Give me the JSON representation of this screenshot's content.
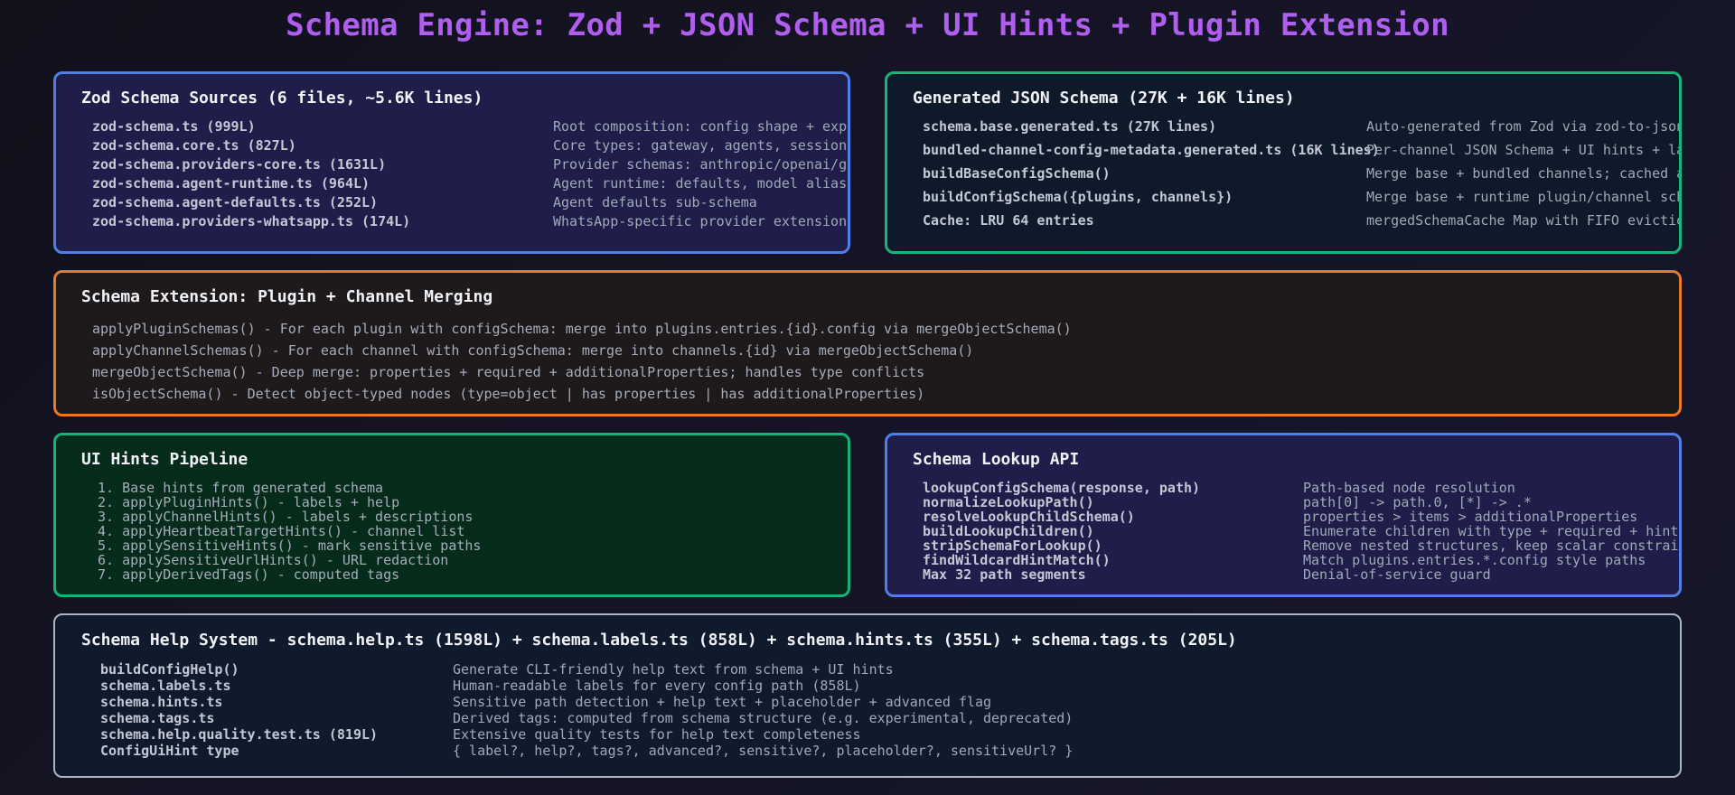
{
  "title": "Schema Engine: Zod + JSON Schema + UI Hints + Plugin Extension",
  "colors": {
    "title": "#b05ef0",
    "blue_border": "#4f7fe6",
    "green_border": "#17b57e",
    "orange_border": "#e8792a",
    "gray_border": "#aeb5c2"
  },
  "zod": {
    "title": "Zod Schema Sources (6 files, ~5.6K lines)",
    "rows": [
      {
        "k": "zod-schema.ts (999L)",
        "v": "Root composition: config shape + exports"
      },
      {
        "k": "zod-schema.core.ts (827L)",
        "v": "Core types: gateway, agents, sessions, lo"
      },
      {
        "k": "zod-schema.providers-core.ts (1631L)",
        "v": "Provider schemas: anthropic/openai/google"
      },
      {
        "k": "zod-schema.agent-runtime.ts (964L)",
        "v": "Agent runtime: defaults, model aliases, c"
      },
      {
        "k": "zod-schema.agent-defaults.ts (252L)",
        "v": "Agent defaults sub-schema"
      },
      {
        "k": "zod-schema.providers-whatsapp.ts (174L)",
        "v": "WhatsApp-specific provider extensions"
      }
    ]
  },
  "json": {
    "title": "Generated JSON Schema (27K + 16K lines)",
    "rows": [
      {
        "k": "schema.base.generated.ts (27K lines)",
        "v": "Auto-generated from Zod via zod-to-json-schema"
      },
      {
        "k": "bundled-channel-config-metadata.generated.ts (16K lines)",
        "v": "Per-channel JSON Schema + UI hints + labels"
      },
      {
        "k": "buildBaseConfigSchema()",
        "v": "Merge base + bundled channels; cached at module"
      },
      {
        "k": "buildConfigSchema({plugins, channels})",
        "v": "Merge base + runtime plugin/channel schemas; S"
      },
      {
        "k": "Cache: LRU 64 entries",
        "v": "mergedSchemaCache Map with FIFO eviction"
      }
    ]
  },
  "ext": {
    "title": "Schema Extension: Plugin + Channel Merging",
    "lines": [
      "applyPluginSchemas() - For each plugin with configSchema: merge into plugins.entries.{id}.config via mergeObjectSchema()",
      "applyChannelSchemas() - For each channel with configSchema: merge into channels.{id} via mergeObjectSchema()",
      "mergeObjectSchema() - Deep merge: properties + required + additionalProperties; handles type conflicts",
      "isObjectSchema() - Detect object-typed nodes (type=object | has properties | has additionalProperties)"
    ]
  },
  "ui": {
    "title": "UI Hints Pipeline",
    "lines": [
      "1. Base hints from generated schema",
      "2. applyPluginHints() - labels + help",
      "3. applyChannelHints() - labels + descriptions",
      "4. applyHeartbeatTargetHints() - channel list",
      "5. applySensitiveHints() - mark sensitive paths",
      "6. applySensitiveUrlHints() - URL redaction",
      "7. applyDerivedTags() - computed tags"
    ]
  },
  "lookup": {
    "title": "Schema Lookup API",
    "rows": [
      {
        "k": "lookupConfigSchema(response, path)",
        "v": "Path-based node resolution"
      },
      {
        "k": "normalizeLookupPath()",
        "v": "path[0] -> path.0, [*] -> .*"
      },
      {
        "k": "resolveLookupChildSchema()",
        "v": "properties > items > additionalProperties"
      },
      {
        "k": "buildLookupChildren()",
        "v": "Enumerate children with type + required + hint"
      },
      {
        "k": "stripSchemaForLookup()",
        "v": "Remove nested structures, keep scalar constraints"
      },
      {
        "k": "findWildcardHintMatch()",
        "v": "Match plugins.entries.*.config style paths"
      },
      {
        "k": "Max 32 path segments",
        "v": "Denial-of-service guard"
      }
    ]
  },
  "help": {
    "title": "Schema Help System - schema.help.ts (1598L) + schema.labels.ts (858L) + schema.hints.ts (355L) + schema.tags.ts (205L)",
    "rows": [
      {
        "k": "buildConfigHelp()",
        "v": "Generate CLI-friendly help text from schema + UI hints"
      },
      {
        "k": "schema.labels.ts",
        "v": "Human-readable labels for every config path (858L)"
      },
      {
        "k": "schema.hints.ts",
        "v": "Sensitive path detection + help text + placeholder + advanced flag"
      },
      {
        "k": "schema.tags.ts",
        "v": "Derived tags: computed from schema structure (e.g. experimental, deprecated)"
      },
      {
        "k": "schema.help.quality.test.ts (819L)",
        "v": "Extensive quality tests for help text completeness"
      },
      {
        "k": "ConfigUiHint type",
        "v": "{ label?, help?, tags?, advanced?, sensitive?, placeholder?, sensitiveUrl? }"
      }
    ]
  }
}
